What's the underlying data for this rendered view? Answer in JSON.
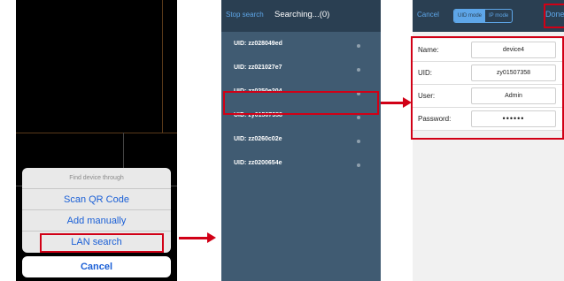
{
  "panel1": {
    "sheet_title": "Find device through",
    "options": [
      "Scan QR Code",
      "Add manually",
      "LAN search"
    ],
    "cancel_label": "Cancel"
  },
  "panel2": {
    "stop_label": "Stop search",
    "title": "Searching...(0)",
    "devices": [
      "UID: zz028049ed",
      "UID: zz021027e7",
      "UID: zz0250e204",
      "UID: zy01507358",
      "UID: zz0260c02e",
      "UID: zz0200654e"
    ]
  },
  "panel3": {
    "cancel_label": "Cancel",
    "seg_left": "UID mode",
    "seg_right": "IP mode",
    "done_label": "Done",
    "fields": [
      {
        "label": "Name:",
        "value": "device4"
      },
      {
        "label": "UID:",
        "value": "zy01507358"
      },
      {
        "label": "User:",
        "value": "Admin"
      },
      {
        "label": "Password:",
        "value": "••••••"
      }
    ]
  },
  "colors": {
    "highlight": "#d10016",
    "ios_blue": "#1a5fd6",
    "nav_bar": "#2a3f52",
    "list_bg": "#405b72"
  }
}
